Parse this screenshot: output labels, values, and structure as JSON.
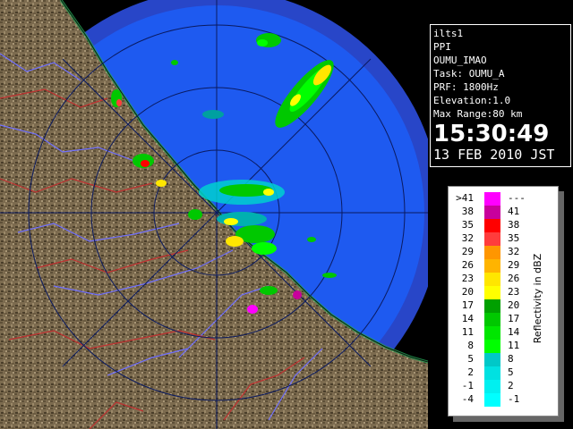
{
  "info": {
    "site": "ilts1",
    "product": "PPI",
    "radar": "OUMU_IMAO",
    "task": "Task: OUMU_A",
    "prf": "PRF: 1800Hz",
    "elevation": "Elevation:1.0",
    "max_range": "Max Range:80 km",
    "time": "15:30:49",
    "date": "13 FEB 2010 JST"
  },
  "legend": {
    "title": "Reflectivity in dBZ",
    "rows": [
      {
        "lo": ">41",
        "hi": "---",
        "color": "#ff00ff"
      },
      {
        "lo": "38",
        "hi": "41",
        "color": "#c8009c"
      },
      {
        "lo": "35",
        "hi": "38",
        "color": "#ff0000"
      },
      {
        "lo": "32",
        "hi": "35",
        "color": "#ff3c3c"
      },
      {
        "lo": "29",
        "hi": "32",
        "color": "#ff9600"
      },
      {
        "lo": "26",
        "hi": "29",
        "color": "#ffb400"
      },
      {
        "lo": "23",
        "hi": "26",
        "color": "#ffe600"
      },
      {
        "lo": "20",
        "hi": "23",
        "color": "#ffff00"
      },
      {
        "lo": "17",
        "hi": "20",
        "color": "#00a000"
      },
      {
        "lo": "14",
        "hi": "17",
        "color": "#00c800"
      },
      {
        "lo": "11",
        "hi": "14",
        "color": "#00e600"
      },
      {
        "lo": "8",
        "hi": "11",
        "color": "#00ff00"
      },
      {
        "lo": "5",
        "hi": "8",
        "color": "#00c8c8"
      },
      {
        "lo": "2",
        "hi": "5",
        "color": "#00e1e1"
      },
      {
        "lo": "-1",
        "hi": "2",
        "color": "#00f0f0"
      },
      {
        "lo": "-4",
        "hi": "-1",
        "color": "#00ffff"
      }
    ]
  },
  "colors": {
    "sea": "#1e5af0",
    "outer_ring": "#2846c8",
    "land": "#7a6a50",
    "river": "#7070ff",
    "boundary": "#c03030"
  }
}
